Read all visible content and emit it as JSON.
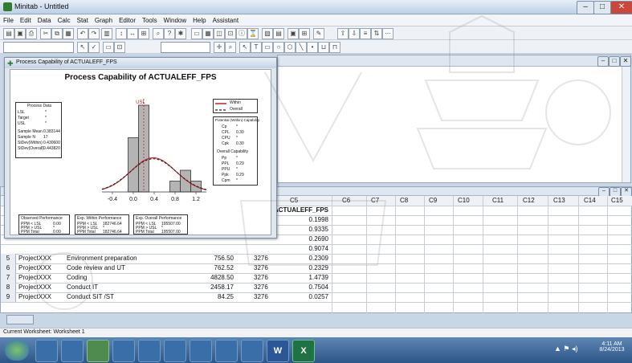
{
  "window": {
    "title": "Minitab - Untitled"
  },
  "menu": [
    "File",
    "Edit",
    "Data",
    "Calc",
    "Stat",
    "Graph",
    "Editor",
    "Tools",
    "Window",
    "Help",
    "Assistant"
  ],
  "chart_window": {
    "title": "Process Capability of ACTUALEFF_FPS"
  },
  "chart_data": {
    "type": "bar",
    "title": "Process Capability of ACTUALEFF_FPS",
    "spec_label": "USL",
    "x_ticks": [
      "-0.4",
      "0.0",
      "0.4",
      "0.8",
      "1.2"
    ],
    "xlim": [
      -0.6,
      1.4
    ],
    "bins": [
      {
        "x": 0.0,
        "count": 5
      },
      {
        "x": 0.2,
        "count": 8
      },
      {
        "x": 0.8,
        "count": 1
      },
      {
        "x": 1.0,
        "count": 2
      },
      {
        "x": 1.2,
        "count": 1
      }
    ],
    "legend": [
      "Within",
      "Overall"
    ],
    "colors": {
      "within": "#c0202a",
      "overall": "#202020",
      "bar": "#b4b4b4"
    }
  },
  "process_data": {
    "title": "Process Data",
    "rows": [
      {
        "label": "LSL",
        "value": "*"
      },
      {
        "label": "Target",
        "value": "*"
      },
      {
        "label": "USL",
        "value": "*"
      },
      {
        "label": "Sample Mean",
        "value": "0.383144"
      },
      {
        "label": "Sample N",
        "value": "17"
      },
      {
        "label": "StDev(Within)",
        "value": "0.430600"
      },
      {
        "label": "StDev(Overall)",
        "value": "0.443820"
      }
    ]
  },
  "potential": {
    "title": "Potential (Within) Capability",
    "rows": [
      {
        "label": "Cp",
        "value": "*"
      },
      {
        "label": "CPL",
        "value": "0.30"
      },
      {
        "label": "CPU",
        "value": "*"
      },
      {
        "label": "Cpk",
        "value": "0.30"
      }
    ]
  },
  "overall_cap": {
    "title": "Overall Capability",
    "rows": [
      {
        "label": "Pp",
        "value": "*"
      },
      {
        "label": "PPL",
        "value": "0.29"
      },
      {
        "label": "PPU",
        "value": "*"
      },
      {
        "label": "Ppk",
        "value": "0.29"
      },
      {
        "label": "Cpm",
        "value": "*"
      }
    ]
  },
  "observed": {
    "title": "Observed Performance",
    "rows": [
      {
        "label": "PPM < LSL",
        "value": "0.00"
      },
      {
        "label": "PPM > USL",
        "value": "*"
      },
      {
        "label": "PPM Total",
        "value": "0.00"
      }
    ]
  },
  "exp_within": {
    "title": "Exp. Within Performance",
    "rows": [
      {
        "label": "PPM < LSL",
        "value": "182746.64"
      },
      {
        "label": "PPM > USL",
        "value": "*"
      },
      {
        "label": "PPM Total",
        "value": "182746.64"
      }
    ]
  },
  "exp_overall": {
    "title": "Exp. Overall Performance",
    "rows": [
      {
        "label": "PPM < LSL",
        "value": "195507.00"
      },
      {
        "label": "PPM > USL",
        "value": "*"
      },
      {
        "label": "PPM Total",
        "value": "195507.00"
      }
    ]
  },
  "worksheet": {
    "columns": [
      "C5",
      "C6",
      "C7",
      "C8",
      "C9",
      "C10",
      "C11",
      "C12",
      "C13",
      "C14",
      "C15"
    ],
    "c5_name": "ACTUALEFF_FPS",
    "c5_values": [
      "0.1998",
      "0.9335",
      "0.2690",
      "0.9074"
    ],
    "rows": [
      {
        "n": "5",
        "project": "ProjectXXX",
        "task": "Environment preparation",
        "hours": "756.50",
        "id": "3276",
        "eff": "0.2309"
      },
      {
        "n": "6",
        "project": "ProjectXXX",
        "task": "Code review and UT",
        "hours": "762.52",
        "id": "3276",
        "eff": "0.2329"
      },
      {
        "n": "7",
        "project": "ProjectXXX",
        "task": "Coding",
        "hours": "4828.50",
        "id": "3276",
        "eff": "1.4739"
      },
      {
        "n": "8",
        "project": "ProjectXXX",
        "task": "Conduct IT",
        "hours": "2458.17",
        "id": "3276",
        "eff": "0.7504"
      },
      {
        "n": "9",
        "project": "ProjectXXX",
        "task": "Conduct SIT /ST",
        "hours": "84.25",
        "id": "3276",
        "eff": "0.0257"
      }
    ]
  },
  "status": {
    "text": "Current Worksheet: Worksheet 1"
  },
  "clock": {
    "time": "4:11 AM",
    "date": "8/24/2013"
  }
}
